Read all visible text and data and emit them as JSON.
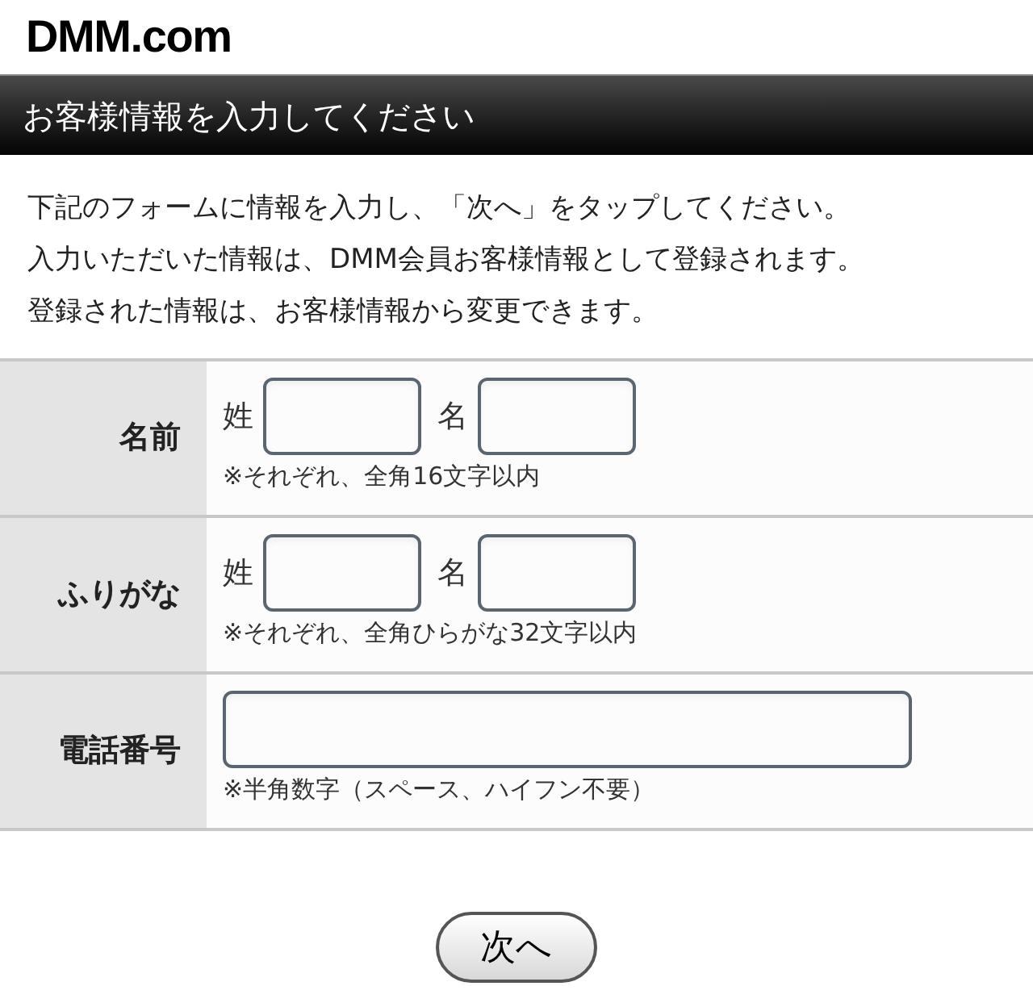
{
  "logo": "DMM.com",
  "header": {
    "title": "お客様情報を入力してください"
  },
  "intro": [
    "下記のフォームに情報を入力し、「次へ」をタップしてください。",
    "入力いただいた情報は、DMM会員お客様情報として登録されます。",
    "登録された情報は、お客様情報から変更できます。"
  ],
  "form_rows": [
    {
      "kind": "pair",
      "label": "名前",
      "first_label": "姓",
      "second_label": "名",
      "note": "※それぞれ、全角16文字以内"
    },
    {
      "kind": "pair",
      "label": "ふりがな",
      "first_label": "姓",
      "second_label": "名",
      "note": "※それぞれ、全角ひらがな32文字以内"
    },
    {
      "kind": "single",
      "label": "電話番号",
      "note": "※半角数字（スペース、ハイフン不要）"
    }
  ],
  "next_button": "次へ"
}
